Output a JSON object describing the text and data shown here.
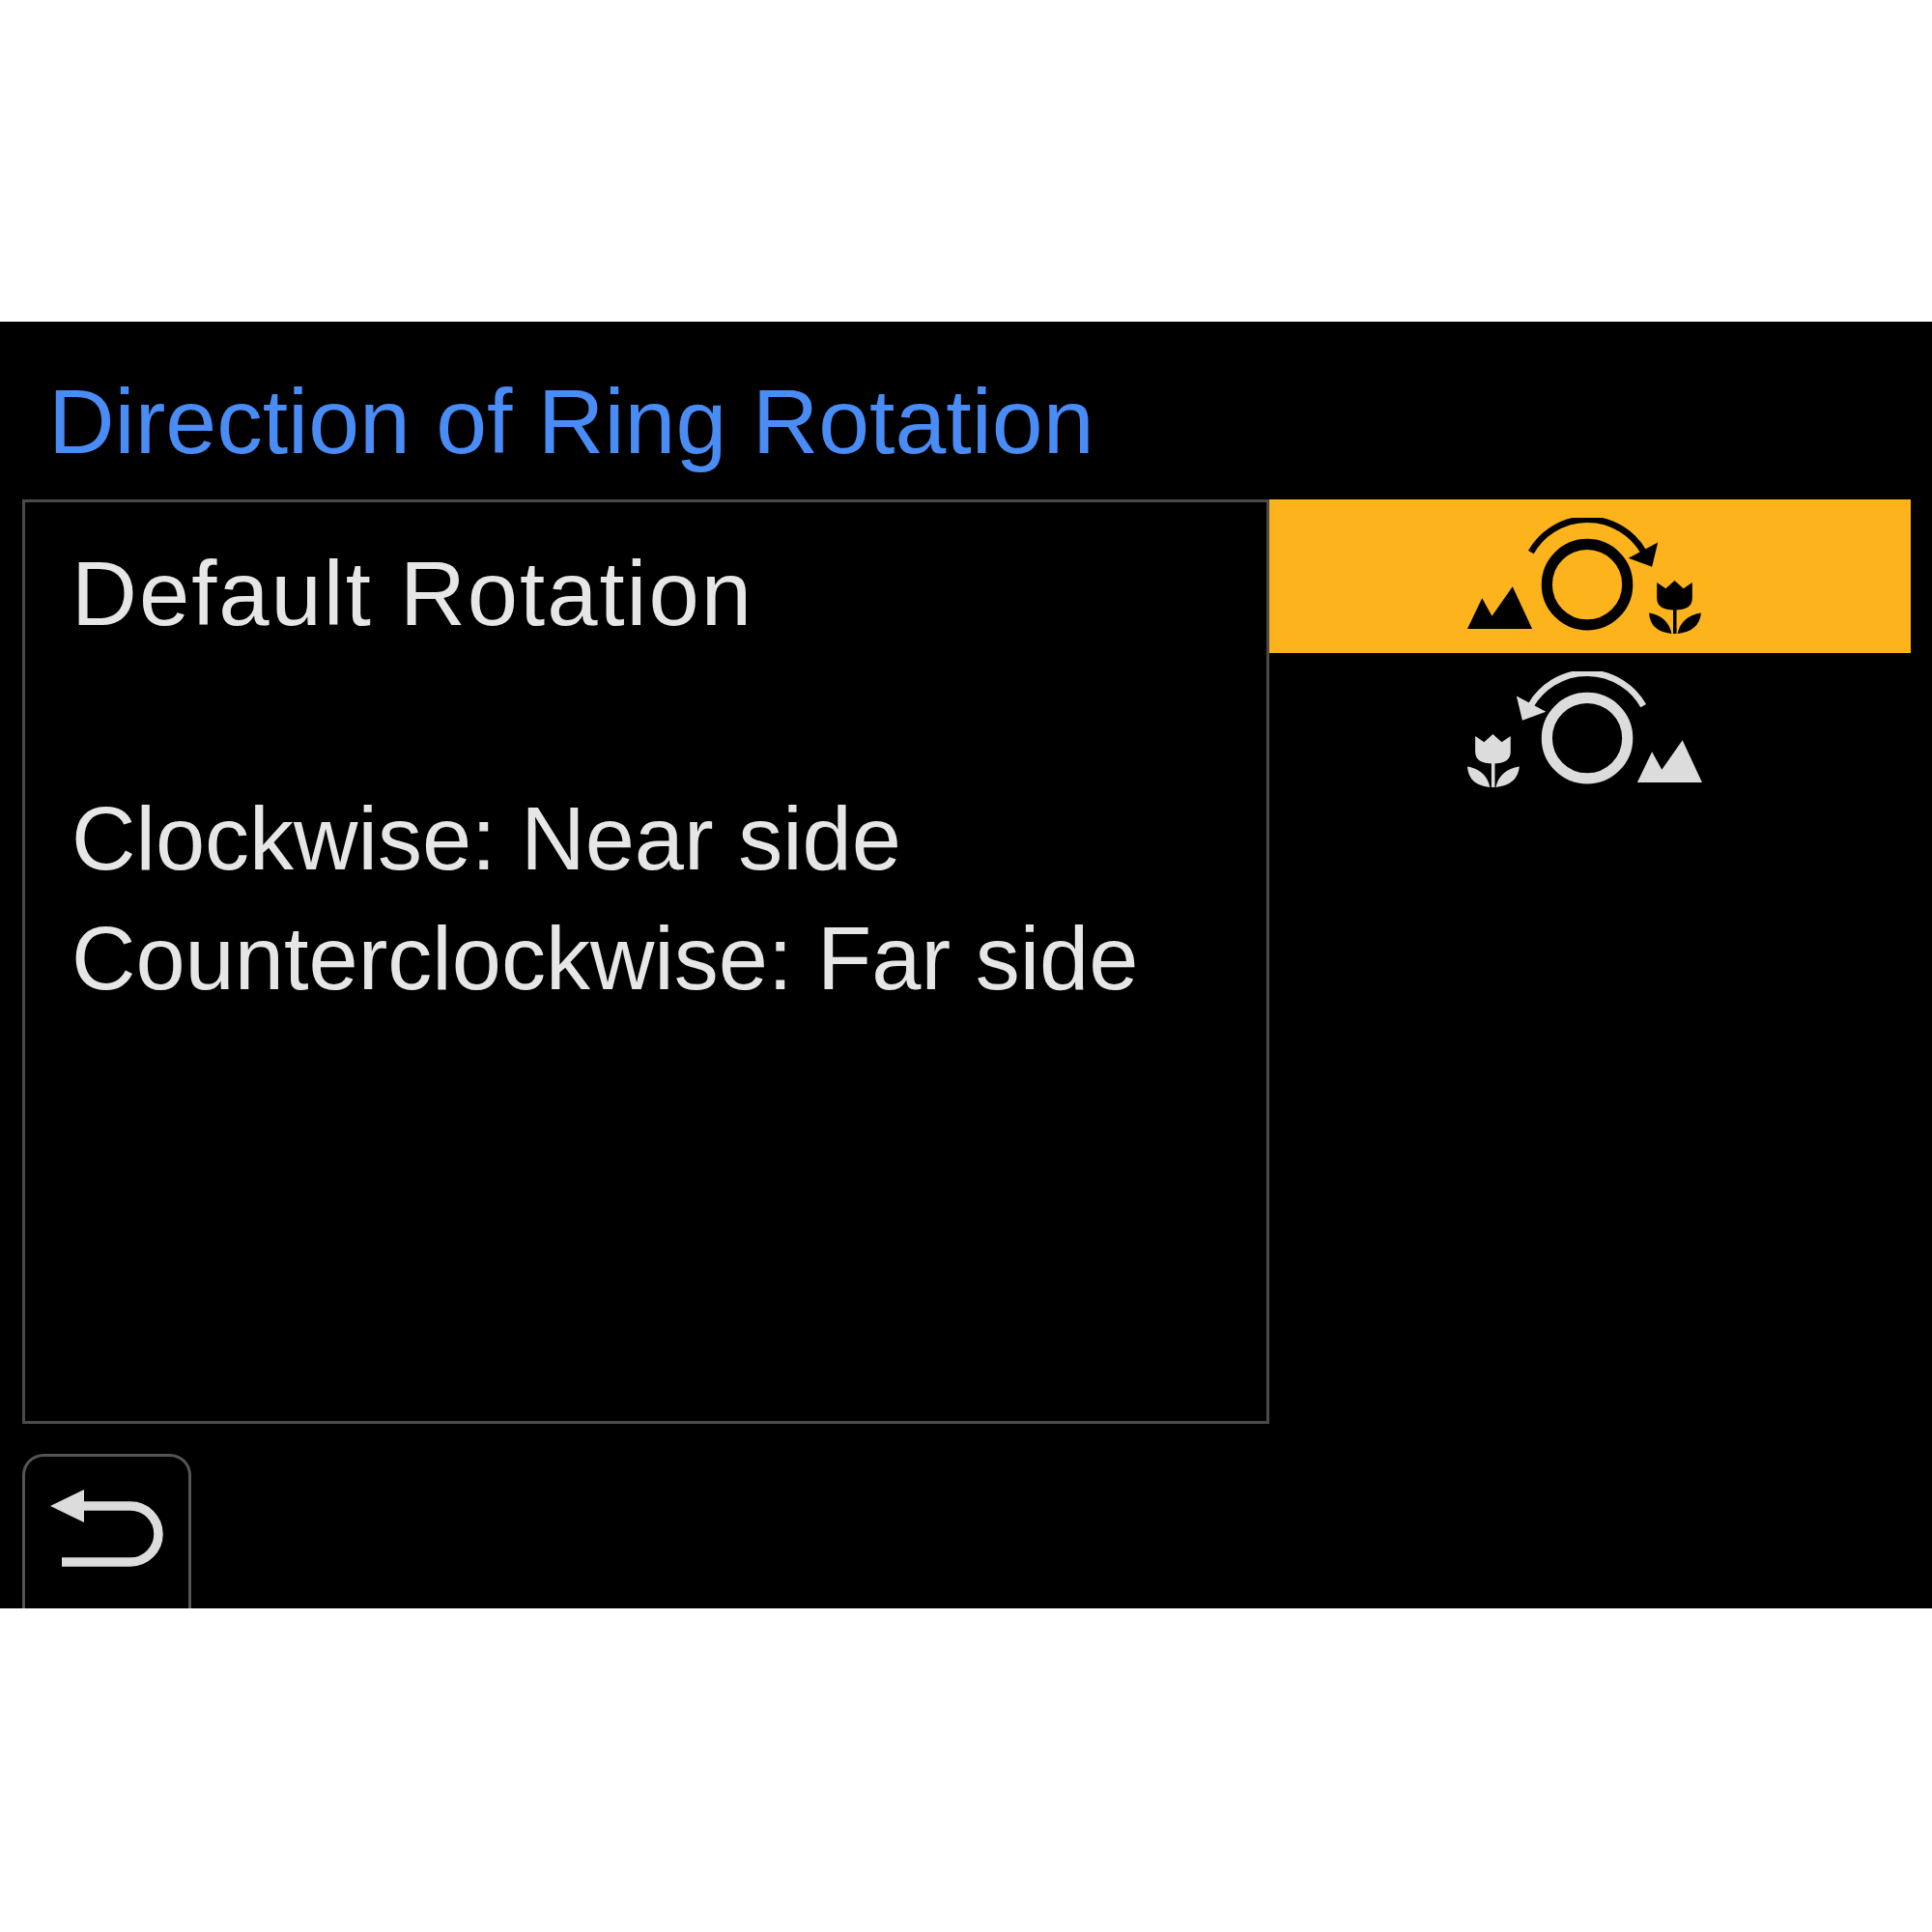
{
  "title": "Direction of Ring Rotation",
  "description": {
    "heading": "Default Rotation",
    "lines": [
      "Clockwise: Near side",
      "Counterclockwise: Far side"
    ]
  },
  "options": [
    {
      "kind": "clockwise",
      "selected": true
    },
    {
      "kind": "counterclockwise",
      "selected": false
    }
  ]
}
